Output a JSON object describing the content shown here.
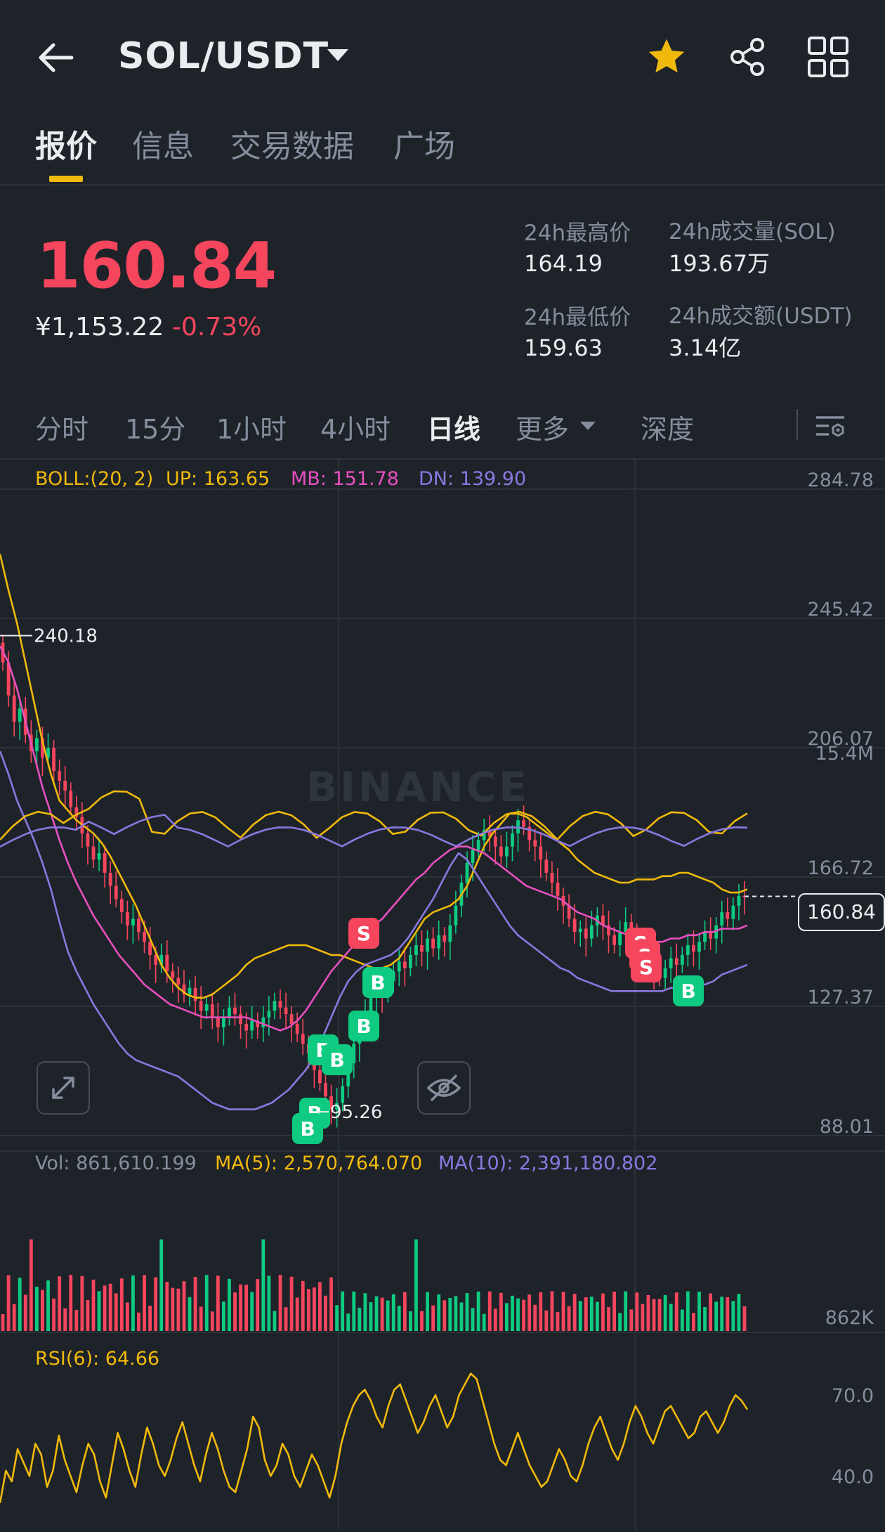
{
  "header": {
    "pair": "SOL/USDT",
    "icons": [
      "back-arrow-icon",
      "caret-down-icon",
      "star-icon",
      "share-icon",
      "grid-icon"
    ]
  },
  "tabs": [
    {
      "label": "报价",
      "active": true
    },
    {
      "label": "信息",
      "active": false
    },
    {
      "label": "交易数据",
      "active": false
    },
    {
      "label": "广场",
      "active": false
    }
  ],
  "price": {
    "last": "160.84",
    "cny": "¥1,153.22",
    "change": "-0.73%"
  },
  "stats": {
    "high_label": "24h最高价",
    "high_value": "164.19",
    "low_label": "24h最低价",
    "low_value": "159.63",
    "vol_label": "24h成交量(SOL)",
    "vol_value": "193.67万",
    "amount_label": "24h成交额(USDT)",
    "amount_value": "3.14亿"
  },
  "intervals": [
    {
      "label": "分时",
      "active": false
    },
    {
      "label": "15分",
      "active": false
    },
    {
      "label": "1小时",
      "active": false
    },
    {
      "label": "4小时",
      "active": false
    },
    {
      "label": "日线",
      "active": true
    },
    {
      "label": "更多",
      "active": false
    },
    {
      "label": "深度",
      "active": false
    }
  ],
  "indicators": {
    "boll_label": "BOLL:(20, 2)",
    "up": "UP: 163.65",
    "mb": "MB: 151.78",
    "dn": "DN: 139.90",
    "vol": "Vol: 861,610.199",
    "ma5": "MA(5): 2,570,764.070",
    "ma10": "MA(10): 2,391,180.802",
    "rsi": "RSI(6): 64.66"
  },
  "watermark": "BINANCE",
  "colors": {
    "up": "#0ecb81",
    "down": "#f6465d",
    "accent": "#f0b90b",
    "boll_up": "#f0b90b",
    "boll_mb": "#e84fbf",
    "boll_dn": "#8a78e0"
  },
  "chart_data": {
    "type": "candlestick",
    "price_axis": [
      "284.78",
      "245.42",
      "206.07",
      "166.72",
      "127.37",
      "88.01"
    ],
    "volume_axis": [
      "15.4M",
      "862K"
    ],
    "rsi_axis": [
      "70.0",
      "40.0"
    ],
    "last_price": "160.84",
    "marked_high": "240.18",
    "marked_low": "95.26",
    "close": [
      232,
      222,
      214,
      218,
      210,
      205,
      209,
      203,
      206,
      199,
      196,
      193,
      188,
      185,
      180,
      176,
      172,
      174,
      168,
      164,
      160,
      156,
      152,
      154,
      150,
      147,
      143,
      140,
      143,
      138,
      136,
      134,
      131,
      133,
      129,
      126,
      128,
      124,
      121,
      124,
      127,
      125,
      122,
      120,
      123,
      121,
      124,
      126,
      129,
      127,
      125,
      122,
      119,
      116,
      113,
      108,
      104,
      100,
      96,
      98,
      103,
      110,
      116,
      122,
      126,
      130,
      134,
      131,
      135,
      138,
      141,
      139,
      143,
      146,
      144,
      148,
      145,
      149,
      147,
      152,
      158,
      165,
      171,
      175,
      178,
      181,
      179,
      176,
      173,
      176,
      180,
      184,
      182,
      178,
      176,
      172,
      168,
      165,
      161,
      158,
      154,
      150,
      151,
      148,
      152,
      155,
      152,
      149,
      146,
      150,
      153,
      149,
      146,
      143,
      141,
      138,
      136,
      139,
      142,
      140,
      143,
      146,
      144,
      147,
      150,
      148,
      152,
      156,
      154,
      158,
      161,
      160.84
    ],
    "boll_up": [
      265,
      254,
      244,
      232,
      220,
      208,
      198,
      190,
      187,
      184,
      182,
      180,
      177,
      173,
      168,
      163,
      158,
      152,
      146,
      140,
      136,
      133,
      131,
      130,
      130,
      131,
      133,
      135,
      137,
      140,
      142,
      143,
      144,
      145,
      146,
      146,
      146,
      145,
      144,
      143,
      143,
      142,
      141,
      140,
      139,
      139,
      140,
      142,
      146,
      150,
      154,
      156,
      157,
      158,
      160,
      164,
      170,
      176,
      180,
      183,
      186,
      186,
      185,
      183,
      181,
      179,
      177,
      175,
      172,
      170,
      168,
      167,
      166,
      165,
      165,
      166,
      166,
      166,
      167,
      167,
      168,
      168,
      167,
      166,
      165,
      163,
      162,
      162,
      163
    ],
    "boll_mb": [
      237,
      232,
      224,
      214,
      204,
      194,
      186,
      178,
      171,
      165,
      160,
      155,
      151,
      147,
      143,
      140,
      137,
      134,
      132,
      130,
      128,
      127,
      126,
      125,
      124,
      124,
      124,
      124,
      124,
      124,
      123,
      122,
      121,
      120,
      121,
      123,
      126,
      130,
      134,
      138,
      141,
      144,
      147,
      150,
      152,
      154,
      157,
      160,
      163,
      166,
      168,
      171,
      173,
      175,
      176,
      176,
      175,
      174,
      172,
      170,
      168,
      166,
      164,
      163,
      162,
      161,
      160,
      158,
      156,
      155,
      154,
      152,
      151,
      150,
      149,
      148,
      147,
      147,
      147,
      148,
      148,
      149,
      149,
      150,
      150,
      151,
      151,
      151,
      152
    ],
    "boll_dn": [
      205,
      198,
      190,
      184,
      178,
      171,
      163,
      153,
      144,
      138,
      133,
      128,
      124,
      120,
      116,
      113,
      111,
      110,
      109,
      108,
      107,
      106,
      104,
      102,
      100,
      98,
      97,
      96,
      96,
      96,
      96,
      97,
      98,
      100,
      102,
      105,
      108,
      112,
      118,
      124,
      130,
      135,
      138,
      140,
      141,
      142,
      143,
      145,
      148,
      152,
      156,
      160,
      165,
      170,
      174,
      172,
      168,
      164,
      160,
      156,
      152,
      149,
      147,
      145,
      143,
      141,
      139,
      138,
      136,
      135,
      134,
      133,
      132,
      132,
      132,
      132,
      132,
      132,
      132,
      133,
      133,
      134,
      134,
      134,
      135,
      137,
      138,
      139,
      140
    ],
    "rsi6": [
      30,
      42,
      38,
      50,
      45,
      40,
      52,
      48,
      36,
      42,
      55,
      46,
      40,
      34,
      44,
      52,
      48,
      38,
      32,
      44,
      56,
      50,
      42,
      36,
      48,
      58,
      52,
      44,
      40,
      46,
      54,
      60,
      52,
      44,
      38,
      48,
      56,
      50,
      42,
      36,
      34,
      42,
      50,
      62,
      58,
      46,
      40,
      44,
      52,
      48,
      40,
      36,
      42,
      48,
      44,
      38,
      32,
      40,
      52,
      60,
      66,
      70,
      72,
      68,
      62,
      58,
      66,
      72,
      74,
      68,
      62,
      56,
      60,
      66,
      70,
      64,
      58,
      62,
      70,
      74,
      78,
      76,
      68,
      60,
      52,
      46,
      44,
      50,
      56,
      50,
      44,
      40,
      36,
      38,
      44,
      50,
      46,
      40,
      38,
      44,
      52,
      58,
      62,
      56,
      50,
      46,
      52,
      60,
      66,
      62,
      56,
      52,
      58,
      64,
      66,
      62,
      58,
      54,
      56,
      62,
      64,
      60,
      56,
      60,
      66,
      70,
      68,
      64.66
    ]
  }
}
